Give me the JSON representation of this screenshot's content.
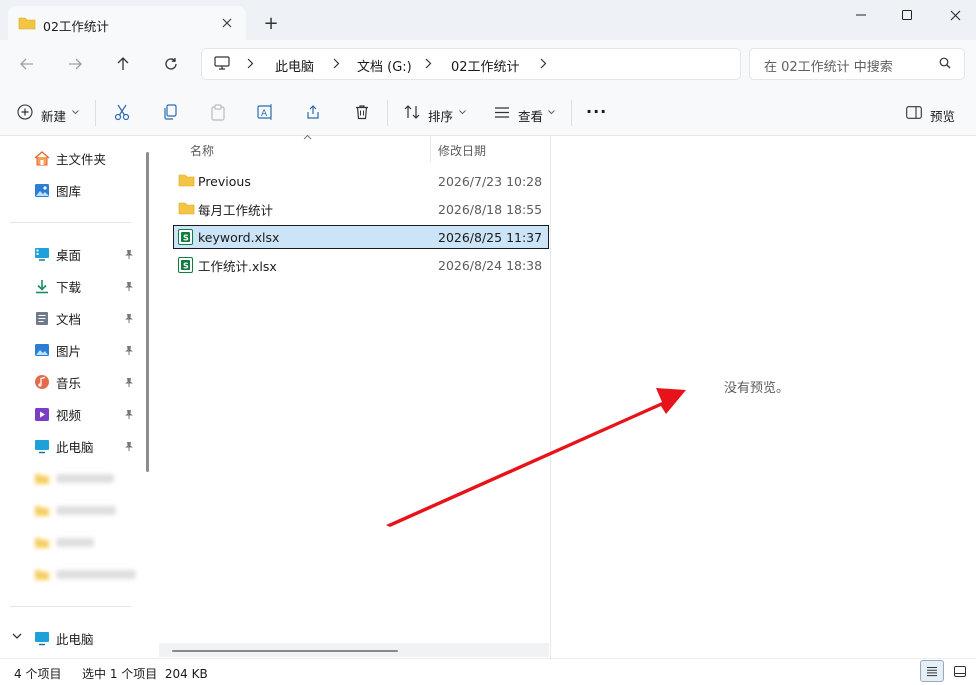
{
  "window": {
    "tab_title": "02工作统计",
    "new_tab_label": "+",
    "controls": [
      "minimize",
      "maximize",
      "close"
    ]
  },
  "address": {
    "breadcrumbs": [
      "此电脑",
      "文档 (G:)",
      "02工作统计"
    ],
    "search_placeholder": "在 02工作统计 中搜索"
  },
  "toolbar": {
    "new_label": "新建",
    "sort_label": "排序",
    "view_label": "查看",
    "more_label": "···",
    "preview_label": "预览"
  },
  "sidebar": {
    "top_items": [
      {
        "label": "主文件夹",
        "icon": "home-icon"
      },
      {
        "label": "图库",
        "icon": "gallery-icon"
      }
    ],
    "pinned_items": [
      {
        "label": "桌面",
        "icon": "desktop-icon"
      },
      {
        "label": "下载",
        "icon": "download-icon"
      },
      {
        "label": "文档",
        "icon": "document-icon"
      },
      {
        "label": "图片",
        "icon": "pictures-icon"
      },
      {
        "label": "音乐",
        "icon": "music-icon"
      },
      {
        "label": "视频",
        "icon": "videos-icon"
      },
      {
        "label": "此电脑",
        "icon": "this-pc-icon"
      }
    ],
    "this_pc_label": "此电脑"
  },
  "filelist": {
    "col_name": "名称",
    "col_date": "修改日期",
    "rows": [
      {
        "name": "Previous",
        "date": "2026/7/23 10:28",
        "type": "folder"
      },
      {
        "name": "每月工作统计",
        "date": "2026/8/18 18:55",
        "type": "folder"
      },
      {
        "name": "keyword.xlsx",
        "date": "2026/8/25 11:37",
        "type": "excel",
        "selected": true
      },
      {
        "name": "工作统计.xlsx",
        "date": "2026/8/24 18:38",
        "type": "excel"
      }
    ]
  },
  "preview": {
    "message": "没有预览。"
  },
  "status": {
    "item_count": "4 个项目",
    "selection": "选中 1 个项目  204 KB"
  },
  "colors": {
    "accent": "#0067c0",
    "folder": "#f4c542",
    "excel": "#107c41",
    "selection": "#cce4f7",
    "arrow": "#e8121a"
  }
}
